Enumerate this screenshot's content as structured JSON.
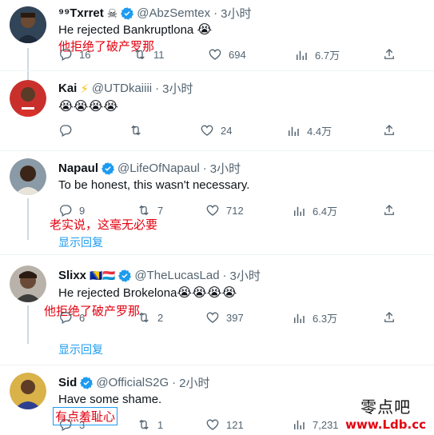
{
  "tweets": [
    {
      "name": "⁹⁹Txrret",
      "badge": "☠",
      "handle": "@AbzSemtex",
      "time": "3小时",
      "text": "He rejected Bankruptlona",
      "emoji": "😭",
      "cn": "他拒绝了破产罗那",
      "replies": "16",
      "retweets": "11",
      "likes": "694",
      "views": "6.7万"
    },
    {
      "name": "Kai",
      "badge": "⚡",
      "handle": "@UTDkaiiii",
      "time": "3小时",
      "text": "",
      "emoji": "😭😭😭😭",
      "replies": "",
      "retweets": "",
      "likes": "24",
      "views": "4.4万"
    },
    {
      "name": "Napaul",
      "handle": "@LifeOfNapaul",
      "time": "3小时",
      "text": "To be honest, this wasn't necessary.",
      "cn": "老实说，这毫无必要",
      "replies": "9",
      "retweets": "7",
      "likes": "712",
      "views": "6.4万",
      "show_replies": "显示回复"
    },
    {
      "name": "Slixx",
      "badge": "🇧🇦🇱🇺",
      "handle": "@TheLucasLad",
      "time": "3小时",
      "text": "He rejected Brokelona",
      "emoji": "😭😭😭😭",
      "cn": "他拒绝了破产罗那",
      "replies": "6",
      "retweets": "2",
      "likes": "397",
      "views": "6.3万",
      "show_replies": "显示回复"
    },
    {
      "name": "Sid",
      "handle": "@OfficialS2G",
      "time": "2小时",
      "text": "Have some shame.",
      "cn": "有点羞耻心",
      "replies": "3",
      "retweets": "1",
      "likes": "121",
      "views": "7,231"
    }
  ],
  "watermark": {
    "title": "零点吧",
    "url": "www.Ldb.cc"
  },
  "colors": {
    "accent": "#1d9bf0",
    "annotation_red": "#e3000f",
    "muted": "#536471"
  }
}
